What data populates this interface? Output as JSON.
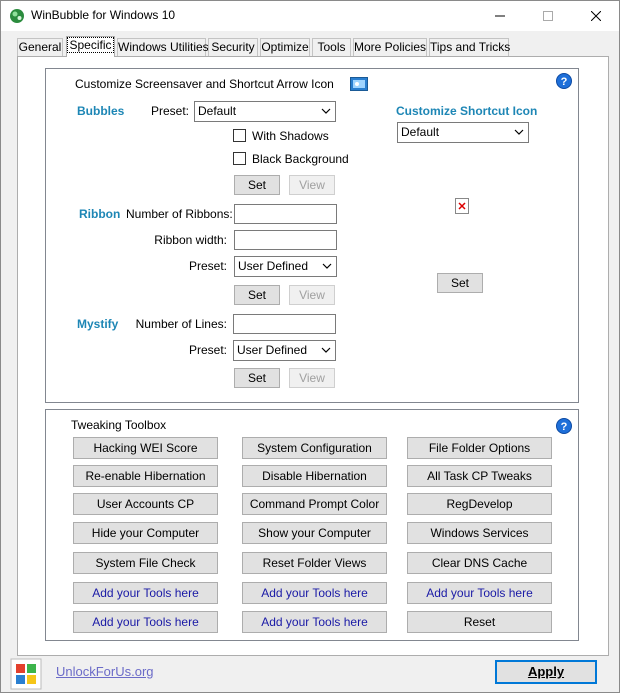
{
  "window": {
    "title": "WinBubble for Windows 10",
    "controls": {
      "minimize": "—",
      "maximize": "☐",
      "close": "✕"
    }
  },
  "tabs": [
    {
      "label": "General"
    },
    {
      "label": "Specific",
      "active": true
    },
    {
      "label": "Windows Utilities"
    },
    {
      "label": "Security"
    },
    {
      "label": "Optimize"
    },
    {
      "label": "Tools"
    },
    {
      "label": "More Policies"
    },
    {
      "label": "Tips and Tricks"
    }
  ],
  "screensaver": {
    "title": "Customize Screensaver and Shortcut Arrow Icon",
    "help": "?",
    "bubbles": {
      "label": "Bubbles",
      "preset_label": "Preset:",
      "preset_value": "Default",
      "with_shadows": "With Shadows",
      "black_background": "Black Background",
      "set": "Set",
      "view": "View"
    },
    "ribbon": {
      "label": "Ribbon",
      "number_label": "Number of Ribbons:",
      "width_label": "Ribbon width:",
      "preset_label": "Preset:",
      "preset_value": "User Defined",
      "set": "Set",
      "view": "View"
    },
    "mystify": {
      "label": "Mystify",
      "number_label": "Number of Lines:",
      "preset_label": "Preset:",
      "preset_value": "User Defined",
      "set": "Set",
      "view": "View"
    },
    "shortcut": {
      "label": "Customize Shortcut Icon",
      "value": "Default",
      "set": "Set"
    }
  },
  "toolbox": {
    "title": "Tweaking Toolbox",
    "help": "?",
    "buttons": [
      [
        "Hacking WEI Score",
        "System Configuration",
        "File Folder Options"
      ],
      [
        "Re-enable Hibernation",
        "Disable Hibernation",
        "All Task CP Tweaks"
      ],
      [
        "User Accounts CP",
        "Command Prompt Color",
        "RegDevelop"
      ],
      [
        "Hide your Computer",
        "Show your Computer",
        "Windows Services"
      ],
      [
        "System File Check",
        "Reset Folder Views",
        "Clear DNS Cache"
      ],
      [
        "Add your Tools here",
        "Add your Tools here",
        "Add your Tools here"
      ],
      [
        "Add your Tools here",
        "Add your Tools here",
        "Reset"
      ]
    ]
  },
  "footer": {
    "link": "UnlockForUs.org",
    "apply": "Apply"
  },
  "colors": {
    "section_label": "#1d86b5",
    "add_tool_text": "#1a1aa6",
    "help_icon": "#1e6fd9",
    "link": "#6b6bc8"
  }
}
